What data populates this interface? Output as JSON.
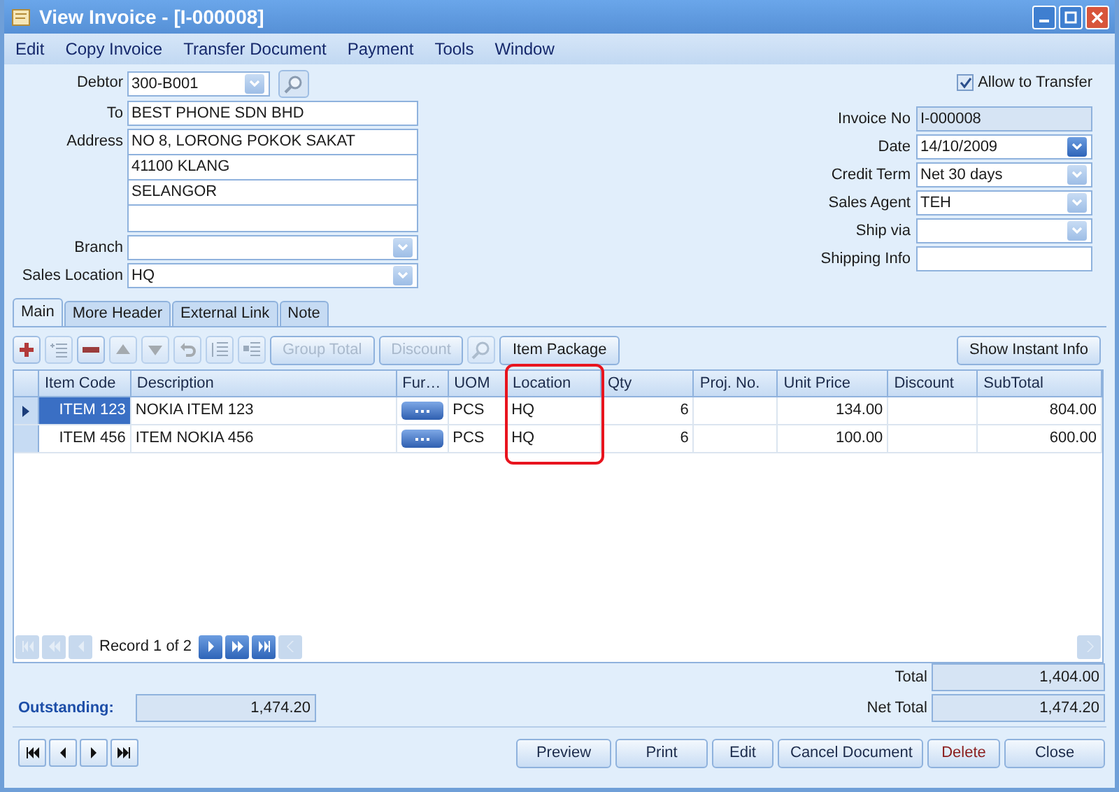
{
  "window": {
    "title": "View Invoice - [I-000008]"
  },
  "menu": [
    "Edit",
    "Copy Invoice",
    "Transfer Document",
    "Payment",
    "Tools",
    "Window"
  ],
  "header_left": [
    {
      "label": "Debtor",
      "value": "300-B001",
      "kind": "lookup"
    },
    {
      "label": "To",
      "value": "BEST PHONE SDN BHD",
      "kind": "text"
    },
    {
      "label": "Address",
      "kind": "address",
      "lines": [
        "NO 8, LORONG POKOK SAKAT",
        "41100 KLANG",
        "SELANGOR"
      ]
    },
    {
      "label": "Branch",
      "kind": "combo"
    },
    {
      "label": "Sales Location",
      "value": "HQ",
      "kind": "combo"
    }
  ],
  "allow_to_transfer": {
    "label": "Allow to Transfer",
    "checked": true
  },
  "header_right": [
    {
      "label": "Invoice No",
      "value": "I-000008",
      "kind": "readonly"
    },
    {
      "label": "Date",
      "value": "14/10/2009",
      "kind": "date"
    },
    {
      "label": "Credit Term",
      "value": "Net 30 days",
      "kind": "combo"
    },
    {
      "label": "Sales Agent",
      "value": "TEH",
      "kind": "combo"
    },
    {
      "label": "Ship via",
      "kind": "combo"
    },
    {
      "label": "Shipping Info",
      "kind": "text"
    }
  ],
  "tabs": [
    {
      "label": "Main",
      "selected": true
    },
    {
      "label": "More Header",
      "selected": false
    },
    {
      "label": "External Link",
      "selected": false
    },
    {
      "label": "Note",
      "selected": false
    }
  ],
  "toolbar_buttons": [
    {
      "label": "Group Total",
      "disabled": true
    },
    {
      "label": "Discount",
      "disabled": true
    },
    {
      "label": "Item Package",
      "disabled": false
    }
  ],
  "instant_info_button": "Show Instant Info",
  "table": {
    "columns": [
      {
        "label": "Item Code",
        "highlighted": false
      },
      {
        "label": "Description",
        "highlighted": false
      },
      {
        "label": "Fur…",
        "highlighted": false
      },
      {
        "label": "UOM",
        "highlighted": false
      },
      {
        "label": "Location",
        "highlighted": true
      },
      {
        "label": "Qty",
        "highlighted": false
      },
      {
        "label": "Proj. No.",
        "highlighted": false
      },
      {
        "label": "Unit Price",
        "highlighted": false
      },
      {
        "label": "Discount",
        "highlighted": false
      },
      {
        "label": "SubTotal",
        "highlighted": false
      }
    ],
    "rows": [
      {
        "selected": true,
        "item_code": "ITEM 123",
        "description": "NOKIA ITEM 123",
        "uom": "PCS",
        "location": "HQ",
        "qty": "6",
        "unit_price": "134.00",
        "subtotal": "804.00"
      },
      {
        "selected": false,
        "item_code": "ITEM 456",
        "description": "ITEM NOKIA 456",
        "uom": "PCS",
        "location": "HQ",
        "qty": "6",
        "unit_price": "100.00",
        "subtotal": "600.00"
      }
    ]
  },
  "record_nav": "Record 1 of 2",
  "outstanding": {
    "label": "Outstanding:",
    "value": "1,474.20"
  },
  "totals": [
    {
      "label": "Total",
      "value": "1,404.00"
    },
    {
      "label": "Net Total",
      "value": "1,474.20"
    }
  ],
  "footer_buttons": [
    {
      "label": "Preview",
      "kind": "normal"
    },
    {
      "label": "Print",
      "kind": "normal"
    },
    {
      "label": "Edit",
      "kind": "normal"
    },
    {
      "label": "Cancel Document",
      "kind": "normal"
    },
    {
      "label": "Delete",
      "kind": "danger"
    },
    {
      "label": "Close",
      "kind": "normal"
    }
  ]
}
